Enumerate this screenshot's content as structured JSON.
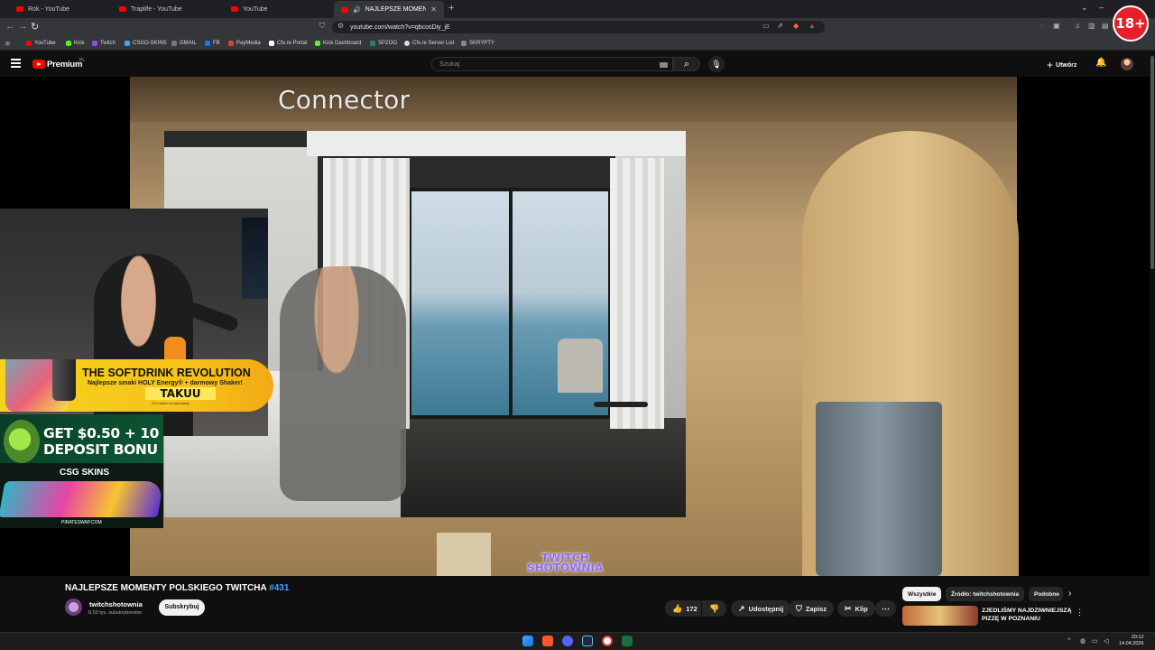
{
  "browser": {
    "tabs": [
      {
        "title": "Rok - YouTube",
        "active": false
      },
      {
        "title": "Traplife - YouTube",
        "active": false
      },
      {
        "title": "YouTube",
        "active": false
      },
      {
        "title": "NAJLEPSZE MOMENTY POLS",
        "active": true
      }
    ],
    "new_tab": "+",
    "url": "youtube.com/watch?v=qbcosDiy_jE",
    "bookmarks": [
      "YouTube",
      "Kick",
      "Twitch",
      "CSGO-SKINS",
      "GMAIL",
      "FB",
      "PayMedia",
      "Cfx.re Portal",
      "Kick Dashboard",
      "SPZOO",
      "Cfx.re Server List",
      "SKRYPTY"
    ],
    "age_badge": "18+"
  },
  "youtube": {
    "brand": "Premium",
    "region": "PL",
    "search_placeholder": "Szukaj",
    "create_label": "Utwórz"
  },
  "player": {
    "overlay_text": "Connector",
    "watermark_line1": "TWITCH",
    "watermark_line2": "SHOTOWNIA",
    "ad_soft": {
      "title": "THE SOFTDRINK REVOLUTION",
      "subtitle": "Najlepsze smaki HOLY Energy® + darmowy Shaker!",
      "brand": "TAKUU",
      "fine": "22% rabatu na zamówienie"
    },
    "ad_csgo": {
      "line1": "GET $0.50 + 10",
      "line2": "DEPOSIT BONU",
      "brand": "CSG SKINS",
      "url": "PIRATESWAP.COM"
    }
  },
  "video": {
    "title": "NAJLEPSZE MOMENTY POLSKIEGO TWITCHA",
    "title_tag": "#431",
    "channel": "twitchshotownia",
    "subscribers": "8,53 tys. subskrybentów",
    "subscribe_label": "Subskrybuj",
    "likes": "172",
    "share_label": "Udostępnij",
    "save_label": "Zapisz",
    "clip_label": "Klip"
  },
  "related": {
    "chips": [
      {
        "label": "Wszystkie",
        "active": true
      },
      {
        "label": "Źródło: twitchshotownia",
        "active": false
      },
      {
        "label": "Podobne",
        "active": false
      }
    ],
    "first_title": "ZJEDLIŚMY NAJDZIWNIEJSZĄ PIZZĘ W POZNANIU"
  },
  "taskbar": {
    "time": "20:12",
    "date": "14.04.2026"
  },
  "colors": {
    "youtube_red": "#ff0000",
    "link_blue": "#3ea6ff",
    "badge_red": "#e5202a"
  }
}
